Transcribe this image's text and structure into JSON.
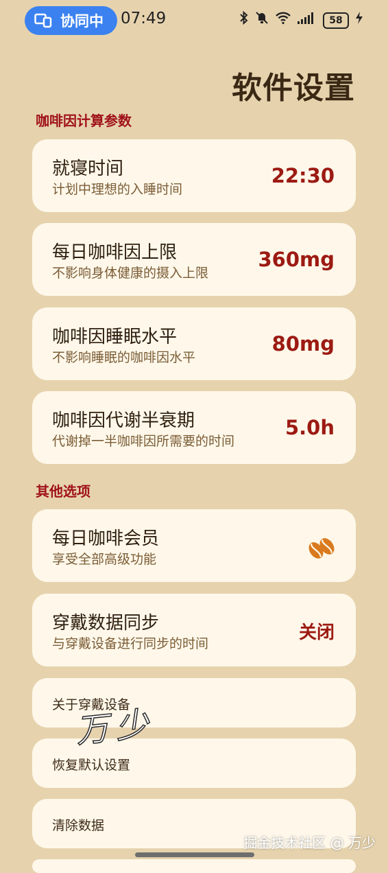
{
  "status_bar": {
    "collab_label": "协同中",
    "time": "07:49",
    "battery": "58",
    "icons": [
      "bluetooth-icon",
      "mute-bell-icon",
      "wifi-icon",
      "signal-icon",
      "charging-icon"
    ]
  },
  "page_title": "软件设置",
  "sections": {
    "caffeine": "咖啡因计算参数",
    "other": "其他选项"
  },
  "caffeine_items": [
    {
      "title": "就寝时间",
      "subtitle": "计划中理想的入睡时间",
      "value": "22:30"
    },
    {
      "title": "每日咖啡因上限",
      "subtitle": "不影响身体健康的摄入上限",
      "value": "360mg"
    },
    {
      "title": "咖啡因睡眠水平",
      "subtitle": "不影响睡眠的咖啡因水平",
      "value": "80mg"
    },
    {
      "title": "咖啡因代谢半衰期",
      "subtitle": "代谢掉一半咖啡因所需要的时间",
      "value": "5.0h"
    }
  ],
  "other_items": [
    {
      "title": "每日咖啡会员",
      "subtitle": "享受全部高级功能",
      "icon": "coffee-beans-icon"
    },
    {
      "title": "穿戴数据同步",
      "subtitle": "与穿戴设备进行同步的时间",
      "value": "关闭"
    }
  ],
  "simple_items": [
    "关于穿戴设备",
    "恢复默认设置",
    "清除数据"
  ],
  "watermark_handwritten": "万少",
  "footer_watermark": "掘金技术社区 @ 万少",
  "colors": {
    "background": "#e6d3ae",
    "card": "#fff8ea",
    "accent_red": "#9c1a13",
    "section_red": "#a0121a",
    "pill_blue": "#3b82f0",
    "bean_orange": "#d97a1e"
  }
}
